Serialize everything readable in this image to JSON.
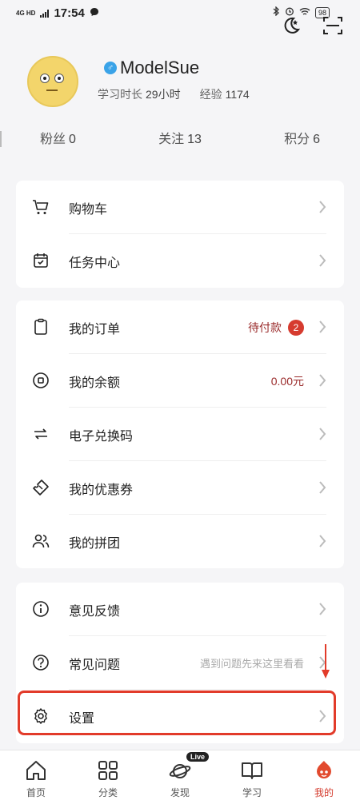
{
  "status_bar": {
    "network": "4G HD",
    "time": "17:54",
    "battery": "98"
  },
  "profile": {
    "username": "ModelSue",
    "study_time_label": "学习时长",
    "study_time_value": "29小时",
    "exp_label": "经验",
    "exp_value": "1174"
  },
  "counters": [
    {
      "label": "粉丝",
      "value": "0"
    },
    {
      "label": "关注",
      "value": "13"
    },
    {
      "label": "积分",
      "value": "6"
    }
  ],
  "group1": [
    {
      "label": "购物车",
      "icon": "cart-icon"
    },
    {
      "label": "任务中心",
      "icon": "calendar-check-icon"
    }
  ],
  "group2": [
    {
      "label": "我的订单",
      "icon": "clipboard-icon",
      "value": "待付款",
      "badge": "2"
    },
    {
      "label": "我的余额",
      "icon": "wallet-coin-icon",
      "value": "0.00元"
    },
    {
      "label": "电子兑换码",
      "icon": "exchange-arrows-icon"
    },
    {
      "label": "我的优惠券",
      "icon": "ticket-icon"
    },
    {
      "label": "我的拼团",
      "icon": "group-users-icon"
    }
  ],
  "group3": [
    {
      "label": "意见反馈",
      "icon": "info-icon"
    },
    {
      "label": "常见问题",
      "icon": "question-icon",
      "hint": "遇到问题先来这里看看"
    },
    {
      "label": "设置",
      "icon": "gear-icon"
    }
  ],
  "tabbar": [
    {
      "label": "首页",
      "icon": "home-icon"
    },
    {
      "label": "分类",
      "icon": "grid-icon"
    },
    {
      "label": "发现",
      "icon": "planet-icon",
      "tag": "Live"
    },
    {
      "label": "学习",
      "icon": "book-icon"
    },
    {
      "label": "我的",
      "icon": "mascot-icon",
      "active": true
    }
  ],
  "colors": {
    "accent": "#d43b2d",
    "highlight": "#e23b2a"
  }
}
